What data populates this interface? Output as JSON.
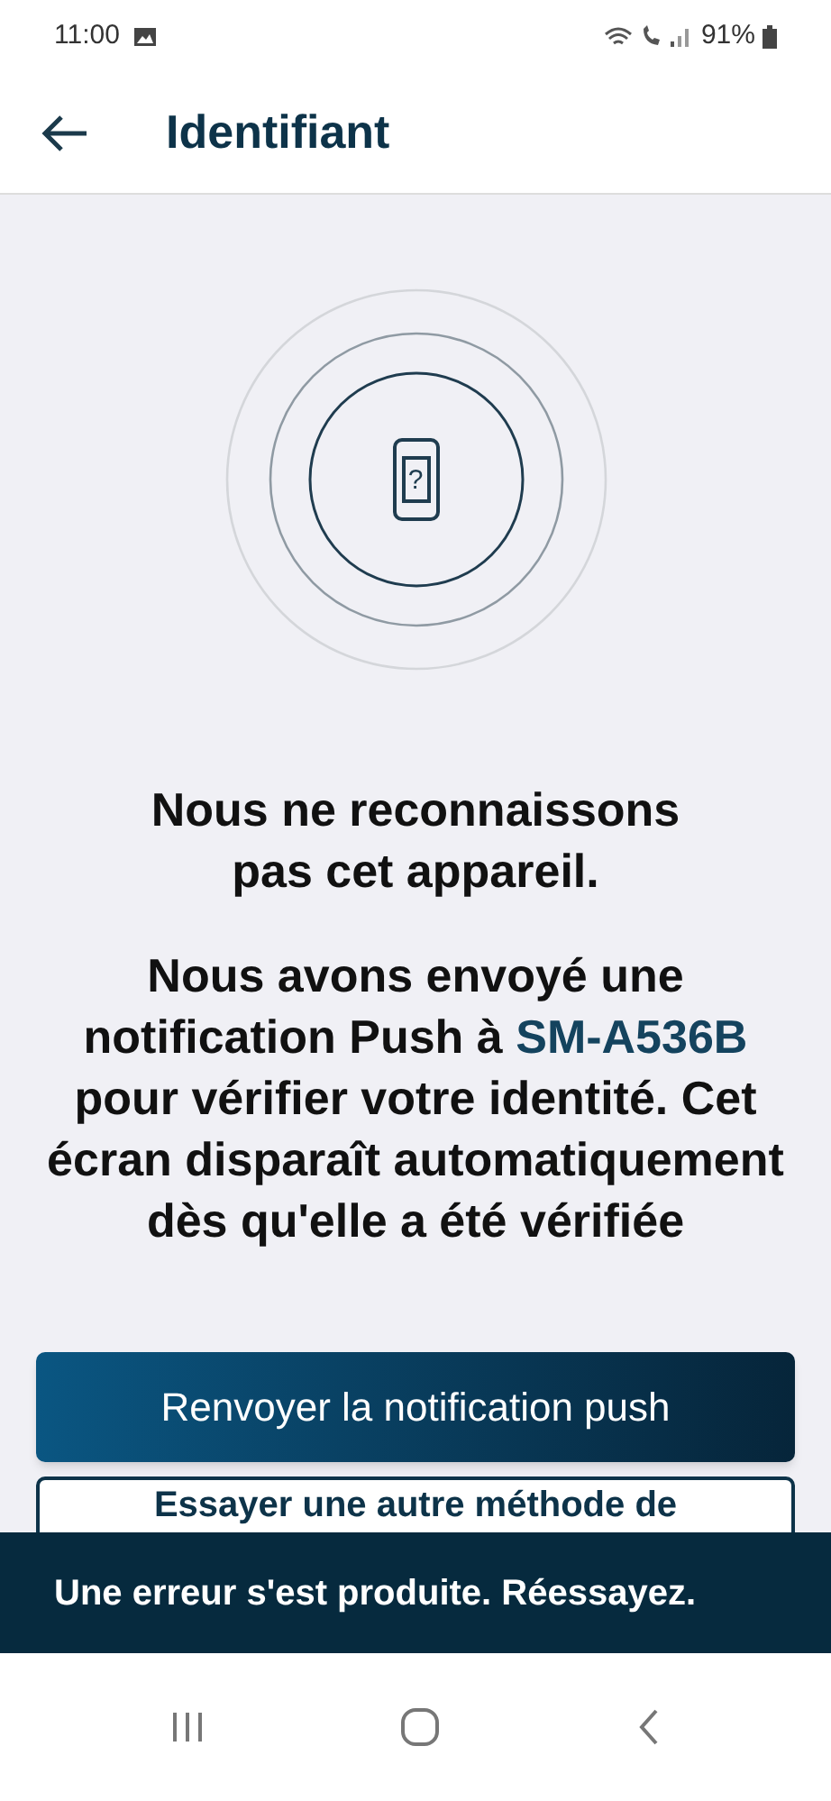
{
  "status_bar": {
    "time": "11:00",
    "battery": "91%"
  },
  "header": {
    "title": "Identifiant"
  },
  "illustration": {
    "glyph": "?"
  },
  "heading": "Nous ne reconnaissons pas cet appareil.",
  "message": {
    "before": "Nous avons envoyé une notification Push à",
    "device": "SM-A536B",
    "after": "pour vérifier votre identité. Cet écran disparaît automatiquement dès qu'elle a été vérifiée"
  },
  "buttons": [
    {
      "kind": "primary",
      "label": "Renvoyer la notification push"
    },
    {
      "kind": "outline",
      "label": "Essayer une autre méthode de"
    }
  ],
  "snackbar": {
    "message": "Une erreur s'est produite. Réessayez."
  }
}
